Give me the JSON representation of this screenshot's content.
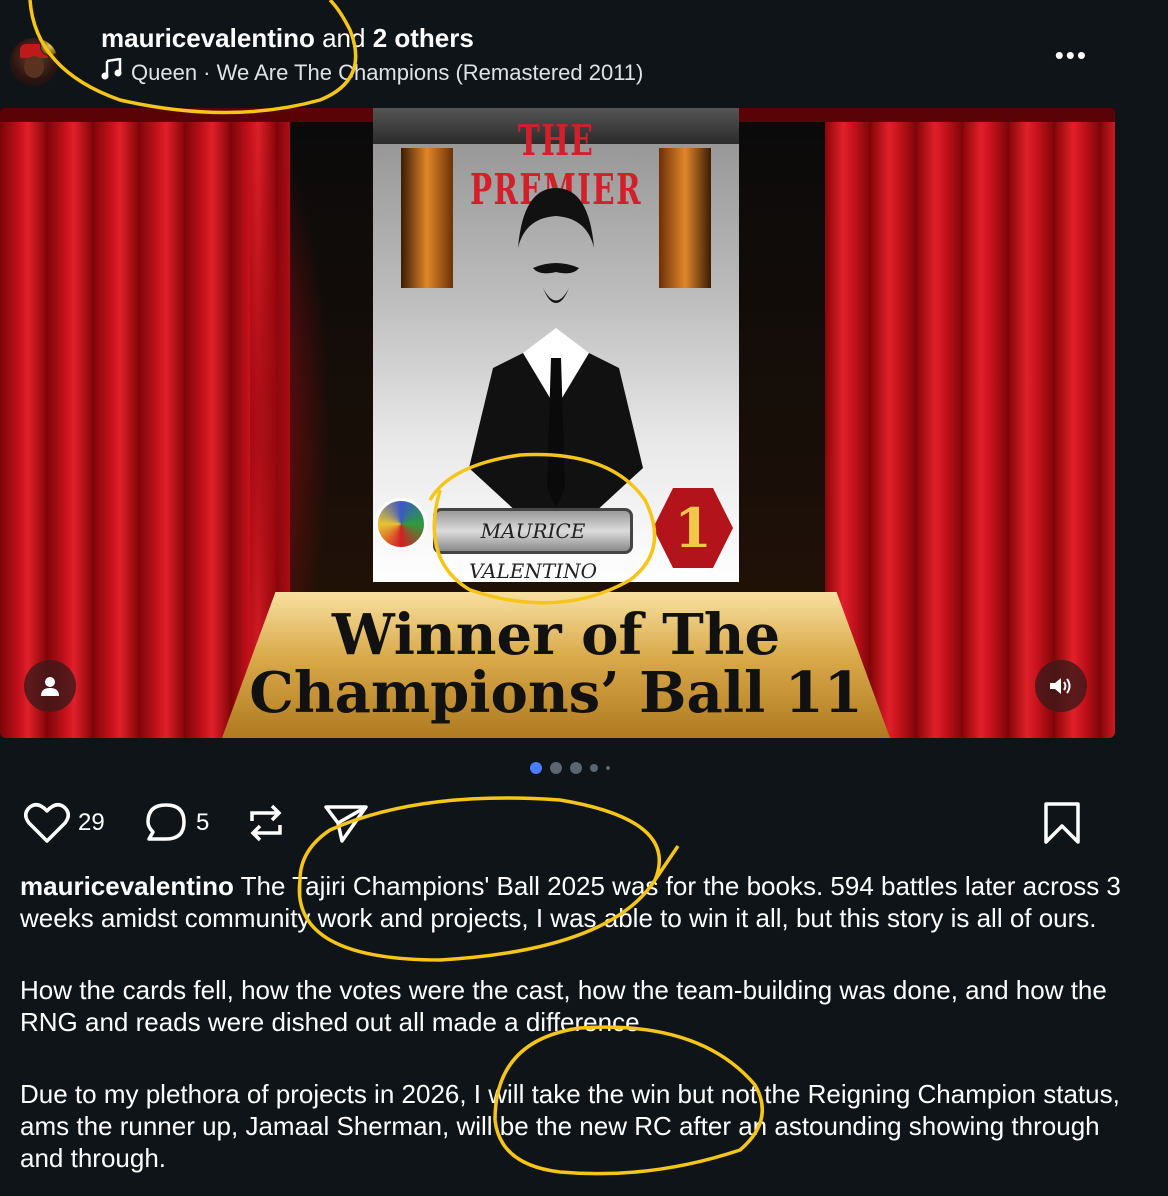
{
  "header": {
    "username": "mauricevalentino",
    "and_text": " and ",
    "others": "2 others",
    "song": "Queen · We Are The Champions (Remastered 2011)",
    "more": "•••"
  },
  "media": {
    "poster_title": "THE PREMIER",
    "nameplate": "MAURICE VALENTINO",
    "rank": "1",
    "banner_line1": "Winner of The",
    "banner_line2": "Champions’ Ball 11",
    "carousel_total": 5,
    "carousel_active": 1
  },
  "actions": {
    "likes": "29",
    "comments": "5"
  },
  "caption": {
    "username": "mauricevalentino",
    "p1": " The Tajiri Champions' Ball 2025 was for the books. 594 battles later across 3 weeks amidst community work and projects, I was able to win it all, but this story is all of ours.",
    "p2": "How the cards fell, how the votes were the cast, how the team-building was done, and how the RNG and reads were dished out all made a difference.",
    "p3": "Due to my plethora of projects in 2026, I will take the win but not the Reigning Champion status, ams the runner up, Jamaal Sherman, will be the new RC after an astounding showing through and through."
  },
  "colors": {
    "background": "#0f1419",
    "accent": "#4a7cff",
    "annotation": "#f5c518"
  }
}
